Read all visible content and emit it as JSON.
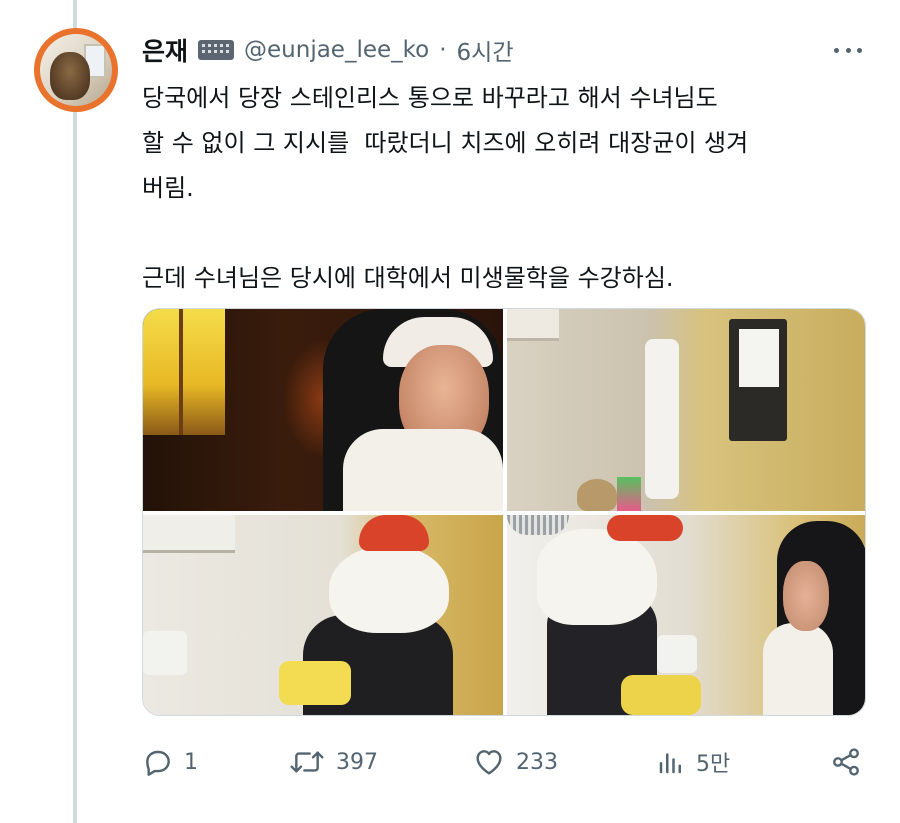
{
  "tweet": {
    "author": {
      "display_name": "은재",
      "badge_icon": "keyboard-icon",
      "handle": "@eunjae_lee_ko",
      "separator": "·",
      "time": "6시간"
    },
    "text": "당국에서 당장 스테인리스 통으로 바꾸라고 해서 수녀님도\n할 수 없이 그 지시를  따랐더니 치즈에 오히려 대장균이 생겨\n버림.\n\n근데 수녀님은 당시에 대학에서 미생물학을 수강하심.",
    "media": [
      {
        "description_icon": "photo"
      },
      {
        "description_icon": "photo"
      },
      {
        "description_icon": "photo"
      },
      {
        "description_icon": "photo"
      }
    ],
    "actions": {
      "replies": "1",
      "retweets": "397",
      "likes": "233",
      "views": "5만"
    }
  },
  "colors": {
    "text_primary": "#0f1419",
    "text_secondary": "#536471",
    "thread_line": "#cfd9de",
    "avatar_ring": "#e9722c"
  }
}
